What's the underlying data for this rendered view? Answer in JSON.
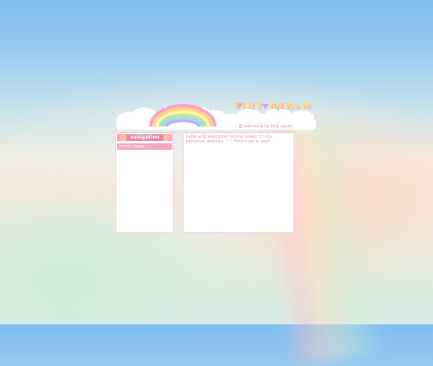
{
  "site": {
    "logo": "TINY REALM",
    "welcome": "welcome to tiny realm"
  },
  "sidebar": {
    "heading": "navigation",
    "items": [
      {
        "label": "home page"
      }
    ]
  },
  "main": {
    "intro": "hello and welcome to tiny realm !!! my personal website ^^ *this text is wip*"
  },
  "colors": {
    "accent_pink": "#f4a7bf",
    "text_pink": "#e88bb0",
    "logo_yellow": "#ffe26a"
  }
}
